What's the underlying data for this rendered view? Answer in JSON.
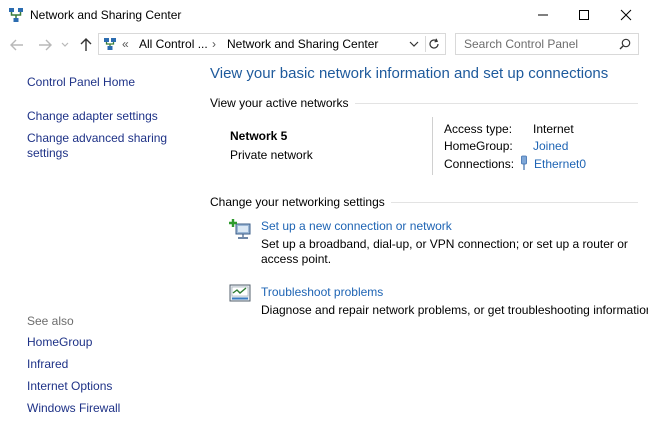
{
  "window": {
    "title": "Network and Sharing Center"
  },
  "address": {
    "overflow": "«",
    "crumbs": [
      "All Control ...",
      "Network and Sharing Center"
    ],
    "separator": "›"
  },
  "search": {
    "placeholder": "Search Control Panel"
  },
  "sidebar": {
    "home": "Control Panel Home",
    "links": [
      "Change adapter settings",
      "Change advanced sharing",
      "settings"
    ],
    "see_also_label": "See also",
    "see_also": [
      "HomeGroup",
      "Infrared",
      "Internet Options",
      "Windows Firewall"
    ]
  },
  "main": {
    "title": "View your basic network information and set up connections",
    "active_networks_heading": "View your active networks",
    "network": {
      "name": "Network  5",
      "type": "Private network"
    },
    "details": {
      "access_type_label": "Access type:",
      "access_type_value": "Internet",
      "homegroup_label": "HomeGroup:",
      "homegroup_value": "Joined",
      "connections_label": "Connections:",
      "connections_value": "Ethernet0"
    },
    "settings_heading": "Change your networking settings",
    "tasks": [
      {
        "title": "Set up a new connection or network",
        "desc_line1": "Set up a broadband, dial-up, or VPN connection; or set up a router or",
        "desc_line2": "access point."
      },
      {
        "title": "Troubleshoot problems",
        "desc_line1": "Diagnose and repair network problems, or get troubleshooting information."
      }
    ]
  },
  "colors": {
    "link": "#1e64b4",
    "heading": "#1e5a9c",
    "nav_link": "#1e3287",
    "muted": "#6d6d6d"
  },
  "icons": [
    "network-app-icon",
    "minimize-icon",
    "maximize-icon",
    "close-icon",
    "back-arrow-icon",
    "forward-arrow-icon",
    "history-chevron-icon",
    "up-arrow-icon",
    "control-panel-icon",
    "dropdown-chevron-icon",
    "refresh-icon",
    "search-icon",
    "ethernet-icon",
    "new-connection-icon",
    "troubleshoot-icon"
  ]
}
